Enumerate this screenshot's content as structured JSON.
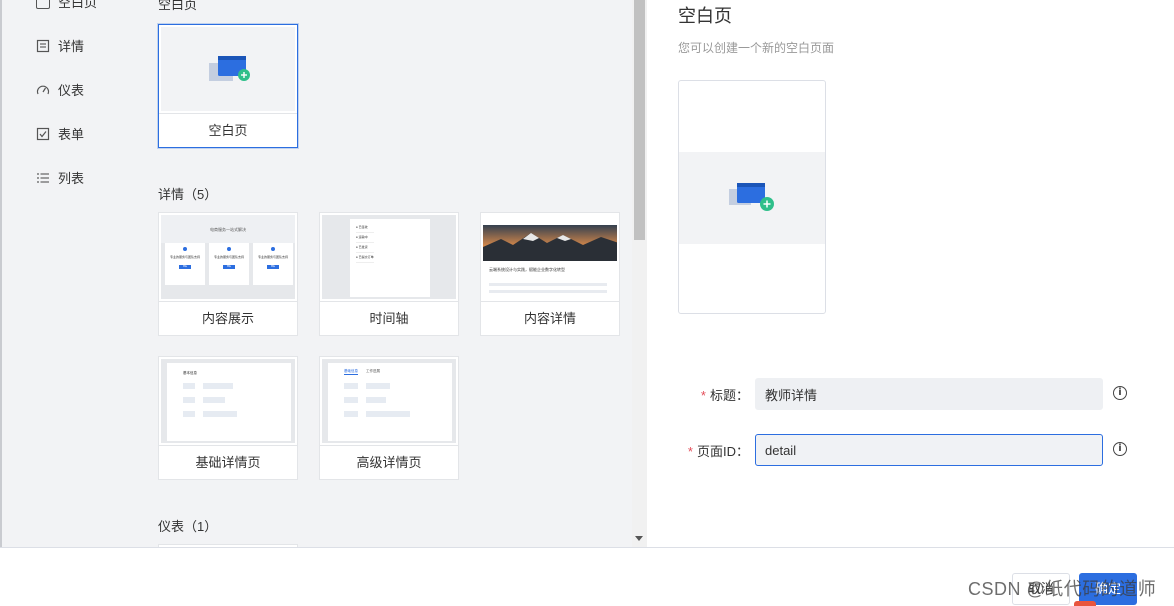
{
  "sidebar": {
    "items": [
      {
        "label": "空白页",
        "icon": "blank-page-icon"
      },
      {
        "label": "详情",
        "icon": "detail-icon"
      },
      {
        "label": "仪表",
        "icon": "dashboard-icon"
      },
      {
        "label": "表单",
        "icon": "form-checkbox-icon"
      },
      {
        "label": "列表",
        "icon": "list-icon"
      }
    ]
  },
  "sections": {
    "blank": {
      "title": "空白页",
      "cards": [
        {
          "label": "空白页"
        }
      ]
    },
    "detail": {
      "title": "详情（5）",
      "cards": [
        {
          "label": "内容展示"
        },
        {
          "label": "时间轴"
        },
        {
          "label": "内容详情"
        },
        {
          "label": "基础详情页"
        },
        {
          "label": "高级详情页"
        }
      ]
    },
    "dashboard": {
      "title": "仪表（1）"
    }
  },
  "thumbs": {
    "content_show": {
      "heading": "电商服务一站式解决",
      "item_text": "专业的服务与团队支持",
      "btn": "查看"
    },
    "timeline": {
      "items": [
        "已签收",
        "运输中",
        "已发货",
        "已提交订单"
      ]
    },
    "content_detail": {
      "headline": "云端系统设计与实践，赋能企业数字化转型"
    },
    "basic_detail": {
      "heading": "基本信息"
    },
    "advanced_detail": {
      "tabs": [
        "基础信息",
        "工作进展"
      ]
    }
  },
  "right": {
    "title": "空白页",
    "description": "您可以创建一个新的空白页面"
  },
  "form": {
    "title_label": "标题：",
    "title_value": "教师详情",
    "id_label": "页面ID：",
    "id_value": "detail"
  },
  "footer": {
    "cancel_label": "取消",
    "confirm_label": "确定",
    "watermark": "CSDN @纸代码的道师"
  },
  "colors": {
    "primary": "#2c6ee0",
    "required": "#e34d59",
    "panel_bg": "#f2f3f5"
  }
}
